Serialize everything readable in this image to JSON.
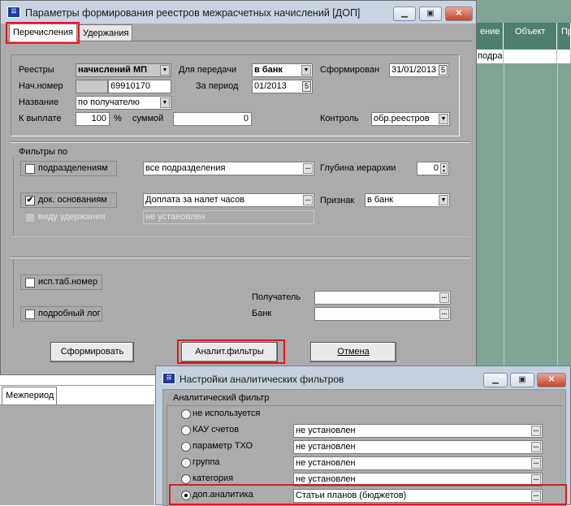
{
  "background_grid": {
    "columns": [
      "ение",
      "Объект",
      "Пр"
    ],
    "first_row_text": "подразд"
  },
  "main_window": {
    "title": "Параметры формирования реестров межрасчетных начислений  [ДОП]",
    "icon": "app-window-icon",
    "tabs": [
      {
        "label": "Перечисления",
        "active": true
      },
      {
        "label": "Удержания",
        "active": false
      }
    ],
    "form": {
      "registry_label": "Реестры",
      "registry_value": "начислений МП",
      "for_transfer_label": "Для передачи",
      "for_transfer_value": "в банк",
      "formed_label": "Сформирован",
      "formed_value": "31/01/2013",
      "start_number_label": "Нач.номер",
      "start_number_value": "69910170",
      "period_label": "За период",
      "period_value": "01/2013",
      "name_label": "Название",
      "name_value": "по получателю",
      "to_pay_label": "К выплате",
      "to_pay_value": "100",
      "percent_sign": "%",
      "sum_label": "суммой",
      "sum_value": "0",
      "control_label": "Контроль",
      "control_value": "обр.реестров"
    },
    "filters": {
      "title": "Фильтры по",
      "by_subdivisions_label": "подразделениям",
      "by_subdivisions_checked": false,
      "subdivisions_value": "все подразделения",
      "hierarchy_depth_label": "Глубина иерархии",
      "hierarchy_depth_value": "0",
      "by_doc_basis_label": "док. основаниям",
      "by_doc_basis_checked": true,
      "doc_basis_value": "Доплата за налет часов",
      "attribute_label": "Признак",
      "attribute_value": "в банк",
      "by_deduction_label": "виду удержания",
      "deduction_value": "не установлен"
    },
    "extra": {
      "use_tab_number_label": "исп.таб.номер",
      "detailed_log_label": "подробный лог",
      "recipient_label": "Получатель",
      "recipient_value": "",
      "bank_label": "Банк",
      "bank_value": ""
    },
    "buttons": {
      "form_label": "Сформировать",
      "analytic_filters_label": "Аналит.фильтры",
      "cancel_label": "Отмена"
    }
  },
  "behind_window": {
    "tab_label": "Межпериод"
  },
  "sub_window": {
    "title": "Настройки аналитических фильтров",
    "group_title": "Аналитический фильтр",
    "options": [
      {
        "label": "не используется",
        "value": null,
        "selected": false
      },
      {
        "label": "КАУ счетов",
        "value": "не установлен",
        "selected": false
      },
      {
        "label": "параметр ТХО",
        "value": "не установлен",
        "selected": false
      },
      {
        "label": "группа",
        "value": "не установлен",
        "selected": false
      },
      {
        "label": "категория",
        "value": "не установлен",
        "selected": false
      },
      {
        "label": "доп.аналитика",
        "value": "Статьи планов (бюджетов)",
        "selected": true
      }
    ]
  },
  "colors": {
    "highlight_border": "#e01818",
    "dialog_gray": "#ababab",
    "grid_green": "#7fa493"
  }
}
